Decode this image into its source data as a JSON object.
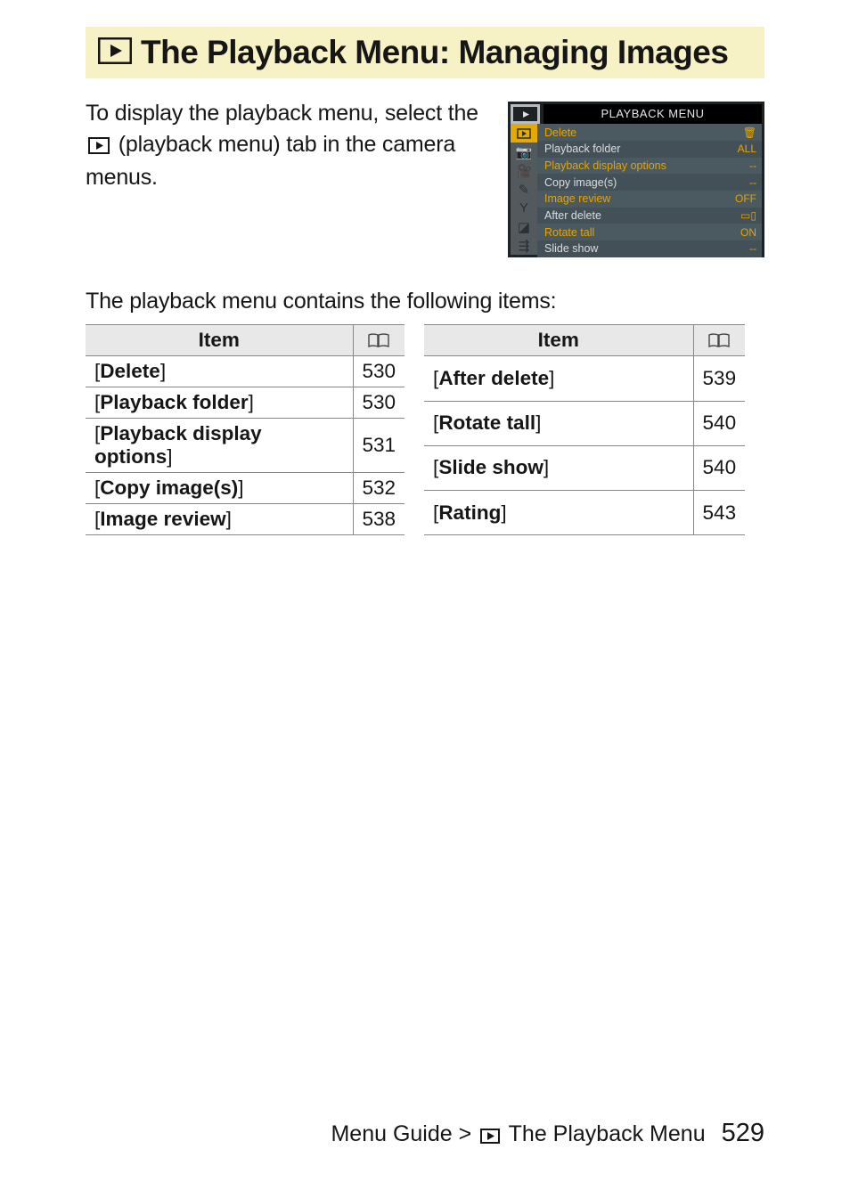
{
  "title": "The Playback Menu: Managing Images",
  "intro": {
    "part1": "To display the playback menu, select the ",
    "part2": " (playback menu) tab in the camera menus."
  },
  "screenshot": {
    "header": "PLAYBACK MENU",
    "rows": [
      {
        "label": "Delete",
        "value": "🗑",
        "primary": true
      },
      {
        "label": "Playback folder",
        "value": "ALL",
        "primary": false
      },
      {
        "label": "Playback display options",
        "value": "--",
        "primary": true
      },
      {
        "label": "Copy image(s)",
        "value": "--",
        "primary": false
      },
      {
        "label": "Image review",
        "value": "OFF",
        "primary": true
      },
      {
        "label": "After delete",
        "value": "▭▯",
        "primary": false
      },
      {
        "label": "Rotate tall",
        "value": "ON",
        "primary": true
      },
      {
        "label": "Slide show",
        "value": "--",
        "primary": false
      }
    ]
  },
  "intro2": "The playback menu contains the following items:",
  "table_header_item": "Item",
  "table1": [
    {
      "label": "Delete",
      "page": "530"
    },
    {
      "label": "Playback folder",
      "page": "530"
    },
    {
      "label": "Playback display options",
      "page": "531"
    },
    {
      "label": "Copy image(s)",
      "page": "532"
    },
    {
      "label": "Image review",
      "page": "538"
    }
  ],
  "table2": [
    {
      "label": "After delete",
      "page": "539"
    },
    {
      "label": "Rotate tall",
      "page": "540"
    },
    {
      "label": "Slide show",
      "page": "540"
    },
    {
      "label": "Rating",
      "page": "543"
    }
  ],
  "footer": {
    "text_left": "Menu Guide > ",
    "text_right": " The Playback Menu",
    "page": "529"
  }
}
